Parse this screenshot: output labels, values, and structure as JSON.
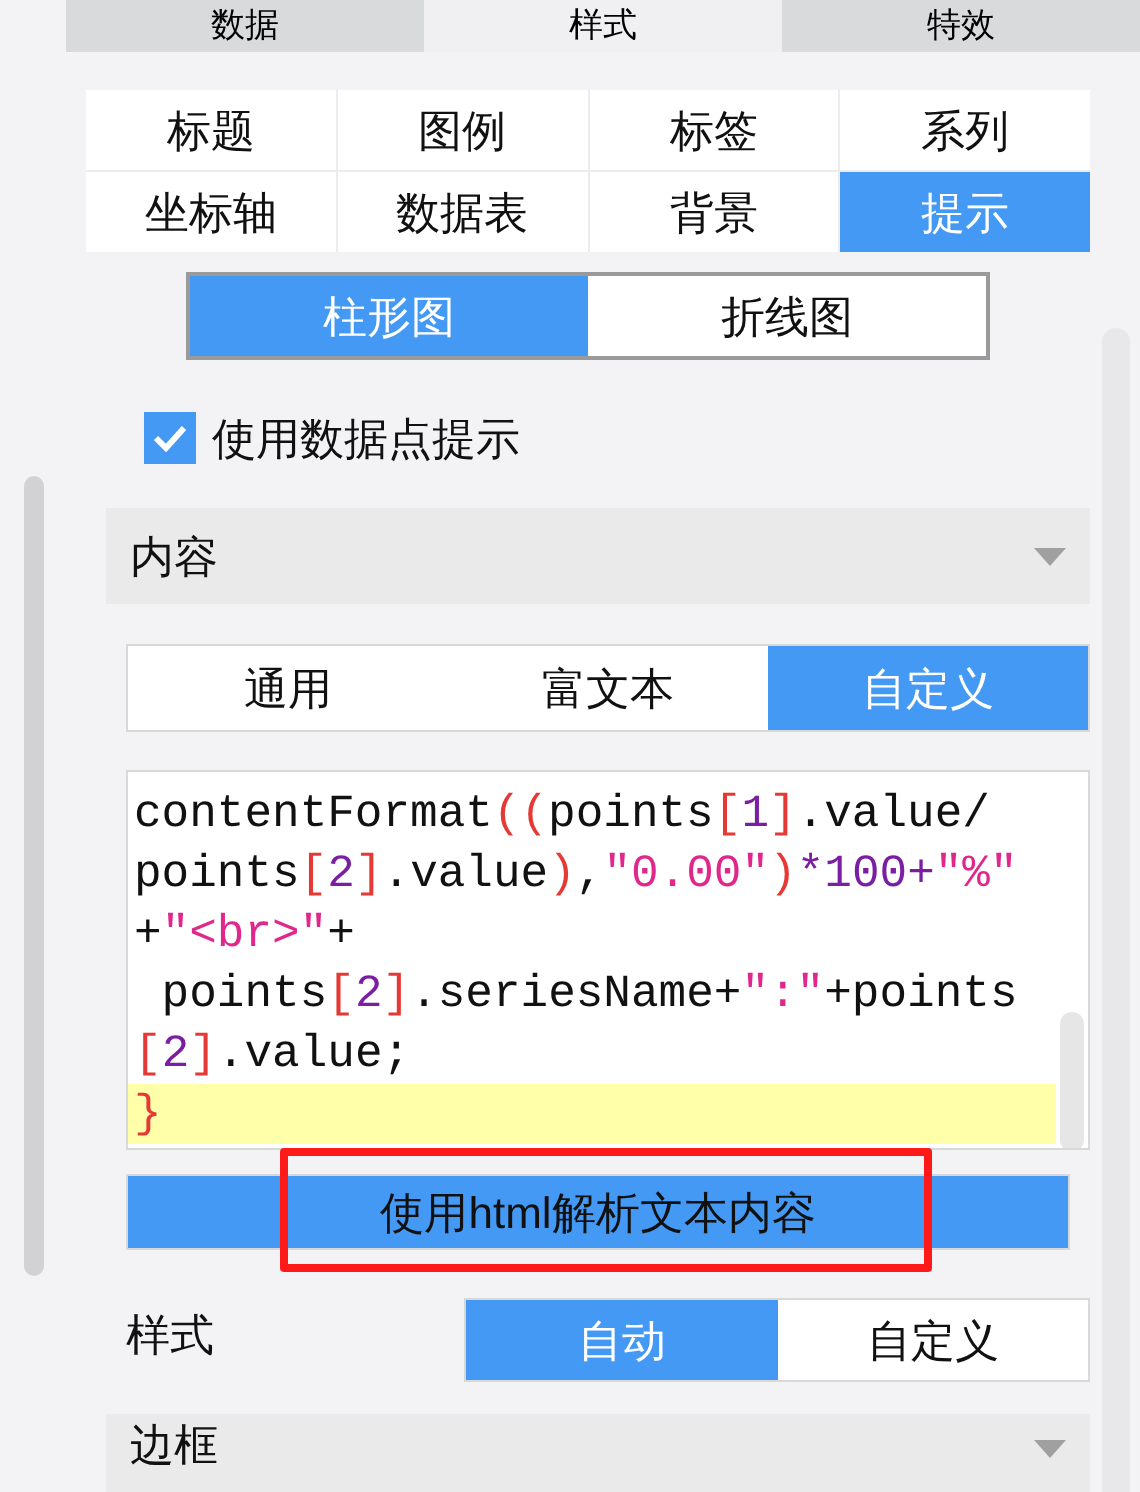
{
  "top_tabs": [
    {
      "label": "数据",
      "selected": false
    },
    {
      "label": "样式",
      "selected": true
    },
    {
      "label": "特效",
      "selected": false
    }
  ],
  "style_tabs": [
    {
      "label": "标题",
      "selected": false
    },
    {
      "label": "图例",
      "selected": false
    },
    {
      "label": "标签",
      "selected": false
    },
    {
      "label": "系列",
      "selected": false
    },
    {
      "label": "坐标轴",
      "selected": false
    },
    {
      "label": "数据表",
      "selected": false
    },
    {
      "label": "背景",
      "selected": false
    },
    {
      "label": "提示",
      "selected": true
    }
  ],
  "chart_types": [
    {
      "label": "柱形图",
      "selected": true
    },
    {
      "label": "折线图",
      "selected": false
    }
  ],
  "use_point_tooltip": {
    "label": "使用数据点提示",
    "checked": true
  },
  "content_section": {
    "title": "内容",
    "expanded": true
  },
  "content_modes": [
    {
      "label": "通用",
      "selected": false
    },
    {
      "label": "富文本",
      "selected": false
    },
    {
      "label": "自定义",
      "selected": true
    }
  ],
  "code_lines": [
    {
      "highlighted": false,
      "tokens": [
        {
          "kind": "plain",
          "text": "contentFormat"
        },
        {
          "kind": "paren",
          "text": "(("
        },
        {
          "kind": "plain",
          "text": "points"
        },
        {
          "kind": "paren",
          "text": "["
        },
        {
          "kind": "num",
          "text": "1"
        },
        {
          "kind": "paren",
          "text": "]"
        },
        {
          "kind": "plain",
          "text": ".value/"
        }
      ]
    },
    {
      "highlighted": false,
      "tokens": [
        {
          "kind": "plain",
          "text": "points"
        },
        {
          "kind": "paren",
          "text": "["
        },
        {
          "kind": "num",
          "text": "2"
        },
        {
          "kind": "paren",
          "text": "]"
        },
        {
          "kind": "plain",
          "text": ".value"
        },
        {
          "kind": "paren",
          "text": ")"
        },
        {
          "kind": "plain",
          "text": ","
        },
        {
          "kind": "str",
          "text": "\"0.00\""
        },
        {
          "kind": "paren",
          "text": ")"
        },
        {
          "kind": "num",
          "text": "*100+"
        },
        {
          "kind": "str",
          "text": "\"%\""
        }
      ]
    },
    {
      "highlighted": false,
      "tokens": [
        {
          "kind": "plain",
          "text": "+"
        },
        {
          "kind": "str",
          "text": "\"<br>\""
        },
        {
          "kind": "plain",
          "text": "+"
        }
      ]
    },
    {
      "highlighted": false,
      "tokens": [
        {
          "kind": "plain",
          "text": " points"
        },
        {
          "kind": "paren",
          "text": "["
        },
        {
          "kind": "num",
          "text": "2"
        },
        {
          "kind": "paren",
          "text": "]"
        },
        {
          "kind": "plain",
          "text": ".seriesName+"
        },
        {
          "kind": "str",
          "text": "\":\""
        },
        {
          "kind": "plain",
          "text": "+points"
        }
      ]
    },
    {
      "highlighted": false,
      "tokens": [
        {
          "kind": "paren",
          "text": "["
        },
        {
          "kind": "num",
          "text": "2"
        },
        {
          "kind": "paren",
          "text": "]"
        },
        {
          "kind": "plain",
          "text": ".value;"
        }
      ]
    },
    {
      "highlighted": true,
      "tokens": [
        {
          "kind": "paren",
          "text": "}"
        }
      ]
    }
  ],
  "html_button": {
    "label": "使用html解析文本内容",
    "selected": true
  },
  "style_row": {
    "label": "样式",
    "options": [
      {
        "label": "自动",
        "selected": true
      },
      {
        "label": "自定义",
        "selected": false
      }
    ]
  },
  "border_section": {
    "title": "边框",
    "expanded": true
  }
}
